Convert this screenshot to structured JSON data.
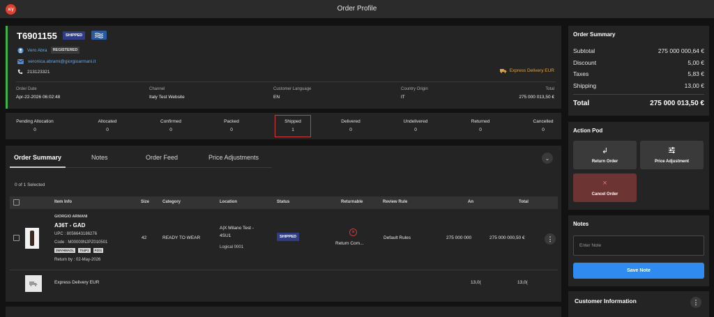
{
  "app": {
    "logo_text": "x/y",
    "title": "Order Profile"
  },
  "order": {
    "id": "T6901155",
    "status_badge": "SHIPPED",
    "customer_name": "Vero Abra",
    "customer_badge": "REGISTERED",
    "email": "veronica.abrami@giorgioarmani.it",
    "phone": "213123321",
    "delivery_method": "Express Delivery EUR",
    "meta": [
      {
        "label": "Order Date",
        "value": "Apr-22-2026 06:02:48"
      },
      {
        "label": "Channel",
        "value": "Italy Test Website"
      },
      {
        "label": "Customer Language",
        "value": "EN"
      },
      {
        "label": "Country Origin",
        "value": "IT"
      },
      {
        "label": "Total",
        "value": "275 000 013,50 €"
      }
    ]
  },
  "statuses": [
    {
      "label": "Pending Allocation",
      "count": "0"
    },
    {
      "label": "Allocated",
      "count": "0"
    },
    {
      "label": "Confirmed",
      "count": "0"
    },
    {
      "label": "Packed",
      "count": "0"
    },
    {
      "label": "Shipped",
      "count": "1"
    },
    {
      "label": "Delivered",
      "count": "0"
    },
    {
      "label": "Undelivered",
      "count": "0"
    },
    {
      "label": "Returned",
      "count": "0"
    },
    {
      "label": "Cancelled",
      "count": "0"
    }
  ],
  "tabs": [
    "Order Summary",
    "Notes",
    "Order Feed",
    "Price Adjustments"
  ],
  "selection_text": "0 of 1 Selected",
  "table": {
    "columns": [
      "Item Info",
      "Size",
      "Category",
      "Location",
      "Status",
      "Returnable",
      "Review Rule",
      "An",
      "Total"
    ],
    "row": {
      "brand": "GIORGIO ARMANI",
      "name": "A36T - GAD",
      "upc": "UPC : 8056643186276",
      "code": "Code : M00000N2PZ010501",
      "tags": [
        "3WVHMAOL",
        "T04P1",
        "PZ01"
      ],
      "return_by": "Return by : 02-May-2026",
      "size": "42",
      "category": "READY TO WEAR",
      "location_line1": "A|X Milano Test -",
      "location_line2": "4SU1",
      "location_sub": "Logical 0001",
      "status": "SHIPPED",
      "returnable": "Return Com...",
      "review_rule": "Default Rules",
      "amount": "275 000 000",
      "total": "275 000 000,50 €"
    },
    "shipping_row": {
      "name": "Express Delivery EUR",
      "amount": "13,0(",
      "total": "13,0("
    }
  },
  "summary": {
    "title": "Order Summary",
    "rows": [
      {
        "label": "Subtotal",
        "value": "275 000 000,64 €"
      },
      {
        "label": "Discount",
        "value": "5,00 €"
      },
      {
        "label": "Taxes",
        "value": "5,83 €"
      },
      {
        "label": "Shipping",
        "value": "13,00 €"
      }
    ],
    "total_label": "Total",
    "total_value": "275 000 013,50 €"
  },
  "action_pod": {
    "title": "Action Pod",
    "return_label": "Return Order",
    "price_label": "Price Adjustment",
    "cancel_label": "Cancel Order"
  },
  "notes": {
    "title": "Notes",
    "placeholder": "Enter Note",
    "save_label": "Save Note"
  },
  "customer_info": {
    "title": "Customer Information"
  },
  "colors": {
    "accent_green": "#3bb54a",
    "shipped_badge": "#2f3d86",
    "primary_blue": "#2f8bf0",
    "cancel_red": "#6d3434",
    "delivery_orange": "#e1a345"
  }
}
